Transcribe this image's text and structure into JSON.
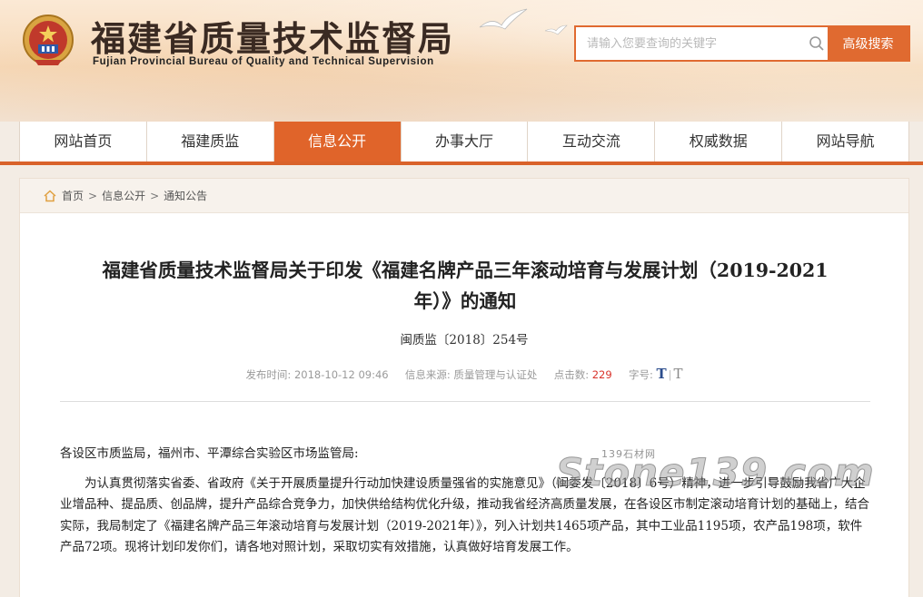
{
  "header": {
    "title": "福建省质量技术监督局",
    "subtitle": "Fujian Provincial Bureau of Quality and Technical Supervision",
    "emblem_icon": "national-emblem-icon",
    "search": {
      "placeholder": "请输入您要查询的关键字",
      "button_label": "高级搜索"
    }
  },
  "nav": {
    "items": [
      {
        "label": "网站首页"
      },
      {
        "label": "福建质监"
      },
      {
        "label": "信息公开"
      },
      {
        "label": "办事大厅"
      },
      {
        "label": "互动交流"
      },
      {
        "label": "权威数据"
      },
      {
        "label": "网站导航"
      }
    ],
    "active_index": 2
  },
  "breadcrumb": {
    "items": [
      "首页",
      "信息公开",
      "通知公告"
    ],
    "separator": ">"
  },
  "article": {
    "title_line1": "福建省质量技术监督局关于印发《福建名牌产品三年滚动培育与发展计划（2019-2021",
    "title_line2": "年）》的通知",
    "doc_number": "闽质监〔2018〕254号",
    "meta": {
      "publish_label": "发布时间:",
      "publish_time": "2018-10-12 09:46",
      "source_label": "信息来源:",
      "source": "质量管理与认证处",
      "clicks_label": "点击数:",
      "clicks": "229",
      "fontsize_label": "字号:",
      "fontsize_large": "T",
      "fontsize_small": "T"
    },
    "salutation": "各设区市质监局，福州市、平潭综合实验区市场监管局:",
    "paragraph": "为认真贯彻落实省委、省政府《关于开展质量提升行动加快建设质量强省的实施意见》（闽委发〔2018〕6号）精神，进一步引导鼓励我省广大企业增品种、提品质、创品牌，提升产品综合竞争力，加快供给结构优化升级，推动我省经济高质量发展，在各设区市制定滚动培育计划的基础上，结合实际，我局制定了《福建名牌产品三年滚动培育与发展计划（2019-2021年）》，列入计划共1465项产品，其中工业品1195项，农产品198项，软件产品72项。现将计划印发你们，请各地对照计划，采取切实有效措施，认真做好培育发展工作。"
  },
  "watermark": {
    "small": "139石材网",
    "big": "Stone139.com"
  },
  "colors": {
    "accent": "#e0642a",
    "clicks": "#d9322a",
    "fontsize_link": "#2b4c8c"
  }
}
